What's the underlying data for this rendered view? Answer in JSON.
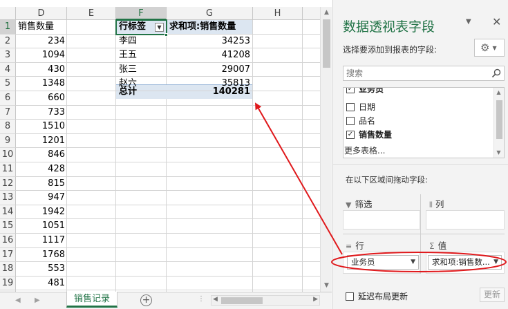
{
  "sheet": {
    "columns": [
      "D",
      "E",
      "F",
      "G",
      "H"
    ],
    "rows": [
      "1",
      "2",
      "3",
      "4",
      "5",
      "6",
      "7",
      "8",
      "9",
      "10",
      "11",
      "12",
      "13",
      "14",
      "15",
      "16",
      "17",
      "18",
      "19",
      "20",
      "21"
    ],
    "d_header": "销售数量",
    "d_values": [
      "234",
      "1094",
      "430",
      "1348",
      "660",
      "733",
      "1510",
      "1201",
      "846",
      "428",
      "815",
      "947",
      "1942",
      "1051",
      "1117",
      "1768",
      "553",
      "481",
      "1923",
      "1215"
    ],
    "pivot": {
      "row_label_header": "行标签",
      "value_header": "求和项:销售数量",
      "rows": [
        {
          "name": "李四",
          "value": "34253"
        },
        {
          "name": "王五",
          "value": "41208"
        },
        {
          "name": "张三",
          "value": "29007"
        },
        {
          "name": "赵六",
          "value": "35813"
        }
      ],
      "total_label": "总计",
      "total_value": "140281"
    },
    "sheet_tab": "销售记录"
  },
  "pane": {
    "title": "数据透视表字段",
    "choose_label": "选择要添加到报表的字段:",
    "search_placeholder": "搜索",
    "fields": [
      {
        "label": "业务员",
        "checked": true
      },
      {
        "label": "日期",
        "checked": false
      },
      {
        "label": "品名",
        "checked": false
      },
      {
        "label": "销售数量",
        "checked": true
      }
    ],
    "more_tables": "更多表格...",
    "drag_label": "在以下区域间拖动字段:",
    "areas": {
      "filter_label": "筛选",
      "columns_label": "列",
      "rows_label": "行",
      "values_label": "值",
      "rows_chip": "业务员",
      "values_chip": "求和项:销售数..."
    },
    "defer_label": "延迟布局更新",
    "update_button": "更新"
  },
  "colors": {
    "excel_green": "#217346",
    "pivot_header_bg": "#dce6f1",
    "annotation_red": "#e0191c"
  }
}
